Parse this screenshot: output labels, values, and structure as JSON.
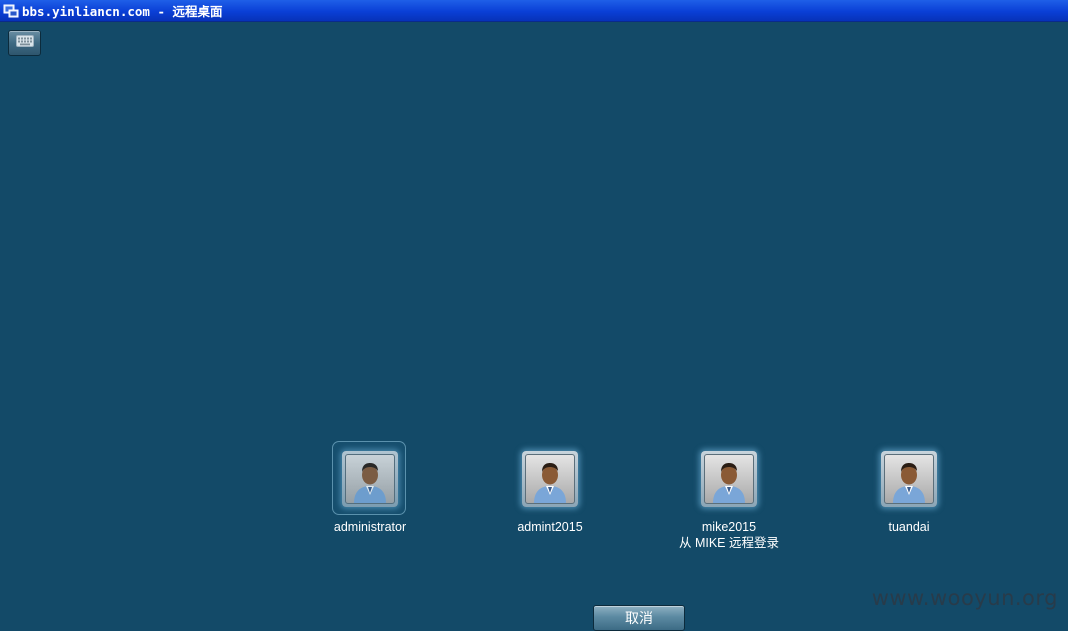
{
  "window": {
    "title": "bbs.yinliancn.com - 远程桌面",
    "icon": "remote-desktop-icon"
  },
  "toolbar": {
    "keyboard_icon": "keyboard-icon"
  },
  "users": [
    {
      "name": "administrator",
      "sub": "",
      "selected": true
    },
    {
      "name": "admint2015",
      "sub": "",
      "selected": false
    },
    {
      "name": "mike2015",
      "sub": "从 MIKE 远程登录",
      "selected": false
    },
    {
      "name": "tuandai",
      "sub": "",
      "selected": false
    }
  ],
  "actions": {
    "cancel_label": "取消"
  },
  "watermark": "www.wooyun.org",
  "colors": {
    "background": "#134a68",
    "titlebar": "#0a3fd6",
    "text": "#ffffff"
  }
}
